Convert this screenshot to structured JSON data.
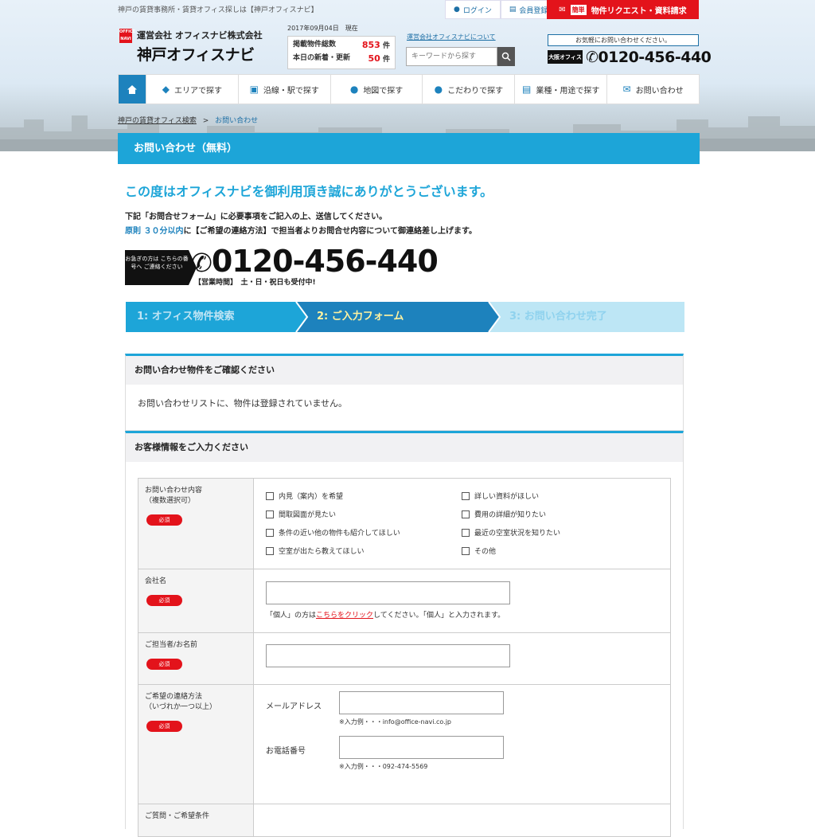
{
  "header": {
    "tagline": "神戸の賃貸事務所・賃貸オフィス探しは【神戸オフィスナビ】",
    "login": "ログイン",
    "register": "会員登録",
    "request_badge": "簡単",
    "request": "物件リクエスト・資料請求",
    "logo_mark": "OFFICE NAVI",
    "company": "運営会社 オフィスナビ株式会社",
    "site_name": "神戸オフィスナビ",
    "date": "2017年09月04日　現在",
    "stat1_label": "掲載物件総数",
    "stat1_value": "853",
    "stat1_unit": "件",
    "stat2_label": "本日の新着・更新",
    "stat2_value": "50",
    "stat2_unit": "件",
    "about": "運営会社オフィスナビについて",
    "search_placeholder": "キーワードから探す",
    "contact_prompt": "お気軽にお問い合わせください。",
    "osaka": "大阪オフィス",
    "tel": "0120-456-440"
  },
  "nav": [
    "エリアで探す",
    "沿線・駅で探す",
    "地図で探す",
    "こだわりで探す",
    "業種・用途で探す",
    "お問い合わせ"
  ],
  "breadcrumb": {
    "home": "神戸の賃貸オフィス検索",
    "sep": ">",
    "current": "お問い合わせ"
  },
  "page_title": "お問い合わせ（無料）",
  "thanks": "この度はオフィスナビを御利用頂き誠にありがとうございます。",
  "intro1": "下記「お問合せフォーム」に必要事項をご記入の上、送信してください。",
  "intro2_blue": "原則 ３０分以内",
  "intro2_rest": "に【ご希望の連絡方法】で担当者よりお問合せ内容について御連絡差し上げます。",
  "urgent_note": "お急ぎの方は こちらの番号へ ご連絡ください",
  "big_tel": "0120-456-440",
  "hours": "【営業時間】　土・日・祝日も受付中!",
  "steps": [
    "1: オフィス物件検索",
    "2: ご入力フォーム",
    "3: お問い合わせ完了"
  ],
  "confirm_section": {
    "title": "お問い合わせ物件をご確認ください",
    "body": "お問い合わせリストに、物件は登録されていません。"
  },
  "customer_section": {
    "title": "お客様情報をご入力ください"
  },
  "required_label": "必須",
  "form": {
    "inquiry_label": "お問い合わせ内容",
    "inquiry_sub": "（複数選択可）",
    "inquiry_options": [
      "内見（案内）を希望",
      "詳しい資料がほしい",
      "間取図面が見たい",
      "費用の詳細が知りたい",
      "条件の近い他の物件も紹介してほしい",
      "最近の空室状況を知りたい",
      "空室が出たら教えてほしい",
      "その他"
    ],
    "company_label": "会社名",
    "company_note_pre": "「個人」の方は",
    "company_note_link": "こちらをクリック",
    "company_note_post": "してください。「個人」と入力されます。",
    "person_label": "ご担当者/お名前",
    "contact_label": "ご希望の連絡方法",
    "contact_sub": "（いづれか一つ以上）",
    "email_label": "メールアドレス",
    "email_example": "※入力例・・・info@office-navi.co.jp",
    "phone_label": "お電話番号",
    "phone_example": "※入力例・・・092-474-5569",
    "next_label": "ご質問・ご希望条件"
  }
}
